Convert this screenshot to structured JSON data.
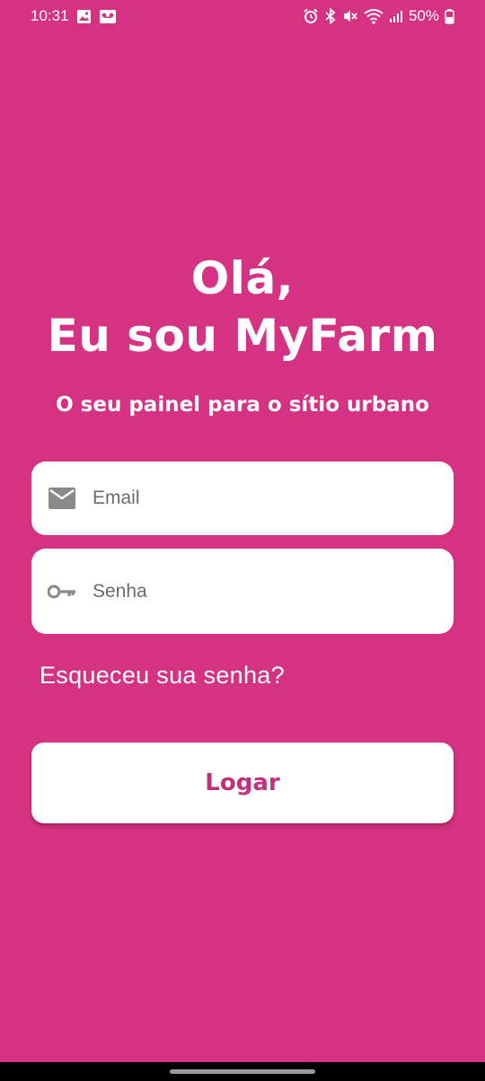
{
  "status_bar": {
    "time": "10:31",
    "battery": "50%",
    "left_icons": [
      "gallery-icon",
      "voicemail-icon"
    ],
    "right_icons": [
      "alarm-icon",
      "bluetooth-icon",
      "mute-icon",
      "wifi-icon",
      "signal-icon",
      "battery-icon"
    ]
  },
  "header": {
    "greeting": "Olá,",
    "title": "Eu sou MyFarm",
    "subtitle": "O seu painel para o sítio urbano"
  },
  "form": {
    "email_placeholder": "Email",
    "password_placeholder": "Senha",
    "forgot_label": "Esqueceu sua senha?",
    "login_label": "Logar"
  },
  "colors": {
    "background": "#d53283",
    "button_text": "#c2307a",
    "field_background": "#ffffff",
    "icon_gray": "#8a8a8a"
  }
}
